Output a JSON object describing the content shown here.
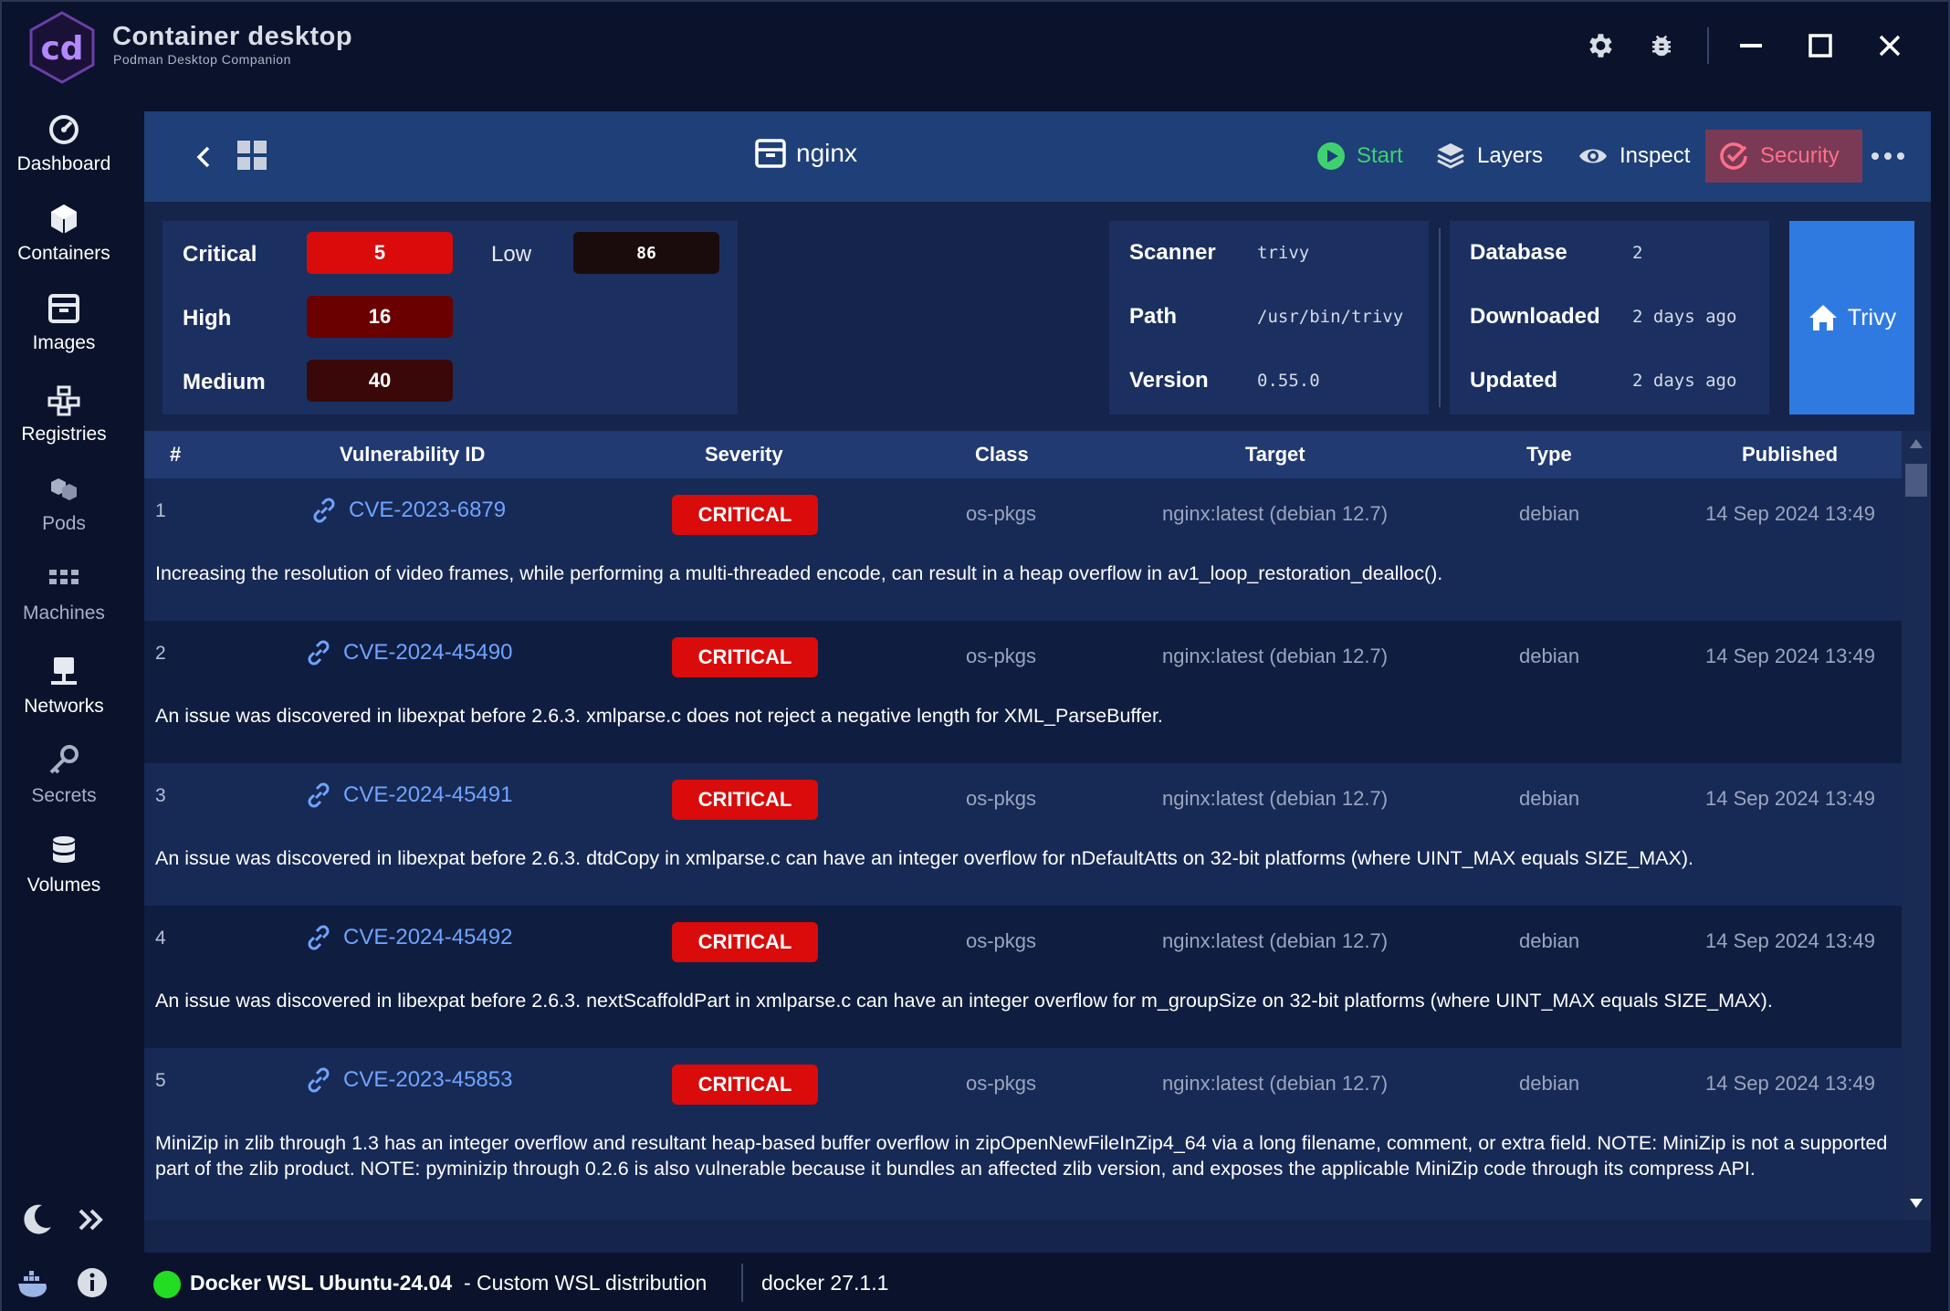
{
  "app": {
    "title": "Container desktop",
    "subtitle": "Podman Desktop Companion",
    "logo_text": "cd"
  },
  "titlebar_icons": [
    "gear-icon",
    "bug-icon",
    "minimize-icon",
    "maximize-icon",
    "close-icon"
  ],
  "sidebar": {
    "items": [
      {
        "label": "Dashboard",
        "icon": "dashboard-icon",
        "state": "active"
      },
      {
        "label": "Containers",
        "icon": "cube-icon",
        "state": "active"
      },
      {
        "label": "Images",
        "icon": "box-icon",
        "state": "active"
      },
      {
        "label": "Registries",
        "icon": "registry-icon",
        "state": "active"
      },
      {
        "label": "Pods",
        "icon": "pods-icon",
        "state": "dim"
      },
      {
        "label": "Machines",
        "icon": "machines-icon",
        "state": "dim"
      },
      {
        "label": "Networks",
        "icon": "network-icon",
        "state": "active"
      },
      {
        "label": "Secrets",
        "icon": "key-icon",
        "state": "dim"
      },
      {
        "label": "Volumes",
        "icon": "database-icon",
        "state": "active"
      }
    ]
  },
  "toolbar": {
    "image_name": "nginx",
    "start_label": "Start",
    "layers_label": "Layers",
    "inspect_label": "Inspect",
    "security_label": "Security"
  },
  "severity": {
    "critical_label": "Critical",
    "critical_count": "5",
    "high_label": "High",
    "high_count": "16",
    "medium_label": "Medium",
    "medium_count": "40",
    "low_label": "Low",
    "low_count": "86"
  },
  "scanner_info": {
    "scanner_label": "Scanner",
    "scanner_value": "trivy",
    "path_label": "Path",
    "path_value": "/usr/bin/trivy",
    "version_label": "Version",
    "version_value": "0.55.0"
  },
  "database_info": {
    "database_label": "Database",
    "database_value": "2",
    "downloaded_label": "Downloaded",
    "downloaded_value": "2 days ago",
    "updated_label": "Updated",
    "updated_value": "2 days ago"
  },
  "trivy_button": "Trivy",
  "table": {
    "headers": [
      "#",
      "Vulnerability ID",
      "Severity",
      "Class",
      "Target",
      "Type",
      "Published"
    ],
    "rows": [
      {
        "index": "1",
        "id": "CVE-2023-6879",
        "severity": "CRITICAL",
        "class": "os-pkgs",
        "target": "nginx:latest (debian 12.7)",
        "type": "debian",
        "published": "14 Sep 2024 13:49",
        "description": "Increasing the resolution of video frames, while performing a multi-threaded encode, can result in a heap overflow in av1_loop_restoration_dealloc()."
      },
      {
        "index": "2",
        "id": "CVE-2024-45490",
        "severity": "CRITICAL",
        "class": "os-pkgs",
        "target": "nginx:latest (debian 12.7)",
        "type": "debian",
        "published": "14 Sep 2024 13:49",
        "description": "An issue was discovered in libexpat before 2.6.3. xmlparse.c does not reject a negative length for XML_ParseBuffer."
      },
      {
        "index": "3",
        "id": "CVE-2024-45491",
        "severity": "CRITICAL",
        "class": "os-pkgs",
        "target": "nginx:latest (debian 12.7)",
        "type": "debian",
        "published": "14 Sep 2024 13:49",
        "description": "An issue was discovered in libexpat before 2.6.3. dtdCopy in xmlparse.c can have an integer overflow for nDefaultAtts on 32-bit platforms (where UINT_MAX equals SIZE_MAX)."
      },
      {
        "index": "4",
        "id": "CVE-2024-45492",
        "severity": "CRITICAL",
        "class": "os-pkgs",
        "target": "nginx:latest (debian 12.7)",
        "type": "debian",
        "published": "14 Sep 2024 13:49",
        "description": "An issue was discovered in libexpat before 2.6.3. nextScaffoldPart in xmlparse.c can have an integer overflow for m_groupSize on 32-bit platforms (where UINT_MAX equals SIZE_MAX)."
      },
      {
        "index": "5",
        "id": "CVE-2023-45853",
        "severity": "CRITICAL",
        "class": "os-pkgs",
        "target": "nginx:latest (debian 12.7)",
        "type": "debian",
        "published": "14 Sep 2024 13:49",
        "description": "MiniZip in zlib through 1.3 has an integer overflow and resultant heap-based buffer overflow in zipOpenNewFileInZip4_64 via a long filename, comment, or extra field. NOTE: MiniZip is not a supported part of the zlib product. NOTE: pyminizip through 0.2.6 is also vulnerable because it bundles an affected zlib version, and exposes the applicable MiniZip code through its compress API."
      }
    ]
  },
  "statusbar": {
    "connection_name": "Docker WSL Ubuntu-24.04",
    "connection_detail": " - Custom WSL distribution",
    "engine_version": "docker 27.1.1"
  },
  "colors": {
    "accent": "#2f7ae0",
    "critical": "#d90b0b",
    "high": "#6b0000",
    "medium": "#3a0808",
    "low": "#1a0c0c",
    "status_ok": "#22dd22",
    "security_active": "#7a3a55"
  }
}
